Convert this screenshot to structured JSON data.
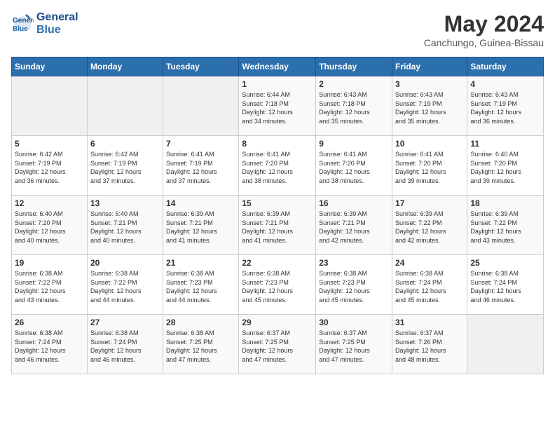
{
  "header": {
    "logo_line1": "General",
    "logo_line2": "Blue",
    "month_year": "May 2024",
    "location": "Canchungo, Guinea-Bissau"
  },
  "calendar": {
    "days_of_week": [
      "Sunday",
      "Monday",
      "Tuesday",
      "Wednesday",
      "Thursday",
      "Friday",
      "Saturday"
    ],
    "weeks": [
      [
        {
          "day": "",
          "info": ""
        },
        {
          "day": "",
          "info": ""
        },
        {
          "day": "",
          "info": ""
        },
        {
          "day": "1",
          "info": "Sunrise: 6:44 AM\nSunset: 7:18 PM\nDaylight: 12 hours\nand 34 minutes."
        },
        {
          "day": "2",
          "info": "Sunrise: 6:43 AM\nSunset: 7:18 PM\nDaylight: 12 hours\nand 35 minutes."
        },
        {
          "day": "3",
          "info": "Sunrise: 6:43 AM\nSunset: 7:19 PM\nDaylight: 12 hours\nand 35 minutes."
        },
        {
          "day": "4",
          "info": "Sunrise: 6:43 AM\nSunset: 7:19 PM\nDaylight: 12 hours\nand 36 minutes."
        }
      ],
      [
        {
          "day": "5",
          "info": "Sunrise: 6:42 AM\nSunset: 7:19 PM\nDaylight: 12 hours\nand 36 minutes."
        },
        {
          "day": "6",
          "info": "Sunrise: 6:42 AM\nSunset: 7:19 PM\nDaylight: 12 hours\nand 37 minutes."
        },
        {
          "day": "7",
          "info": "Sunrise: 6:41 AM\nSunset: 7:19 PM\nDaylight: 12 hours\nand 37 minutes."
        },
        {
          "day": "8",
          "info": "Sunrise: 6:41 AM\nSunset: 7:20 PM\nDaylight: 12 hours\nand 38 minutes."
        },
        {
          "day": "9",
          "info": "Sunrise: 6:41 AM\nSunset: 7:20 PM\nDaylight: 12 hours\nand 38 minutes."
        },
        {
          "day": "10",
          "info": "Sunrise: 6:41 AM\nSunset: 7:20 PM\nDaylight: 12 hours\nand 39 minutes."
        },
        {
          "day": "11",
          "info": "Sunrise: 6:40 AM\nSunset: 7:20 PM\nDaylight: 12 hours\nand 39 minutes."
        }
      ],
      [
        {
          "day": "12",
          "info": "Sunrise: 6:40 AM\nSunset: 7:20 PM\nDaylight: 12 hours\nand 40 minutes."
        },
        {
          "day": "13",
          "info": "Sunrise: 6:40 AM\nSunset: 7:21 PM\nDaylight: 12 hours\nand 40 minutes."
        },
        {
          "day": "14",
          "info": "Sunrise: 6:39 AM\nSunset: 7:21 PM\nDaylight: 12 hours\nand 41 minutes."
        },
        {
          "day": "15",
          "info": "Sunrise: 6:39 AM\nSunset: 7:21 PM\nDaylight: 12 hours\nand 41 minutes."
        },
        {
          "day": "16",
          "info": "Sunrise: 6:39 AM\nSunset: 7:21 PM\nDaylight: 12 hours\nand 42 minutes."
        },
        {
          "day": "17",
          "info": "Sunrise: 6:39 AM\nSunset: 7:22 PM\nDaylight: 12 hours\nand 42 minutes."
        },
        {
          "day": "18",
          "info": "Sunrise: 6:39 AM\nSunset: 7:22 PM\nDaylight: 12 hours\nand 43 minutes."
        }
      ],
      [
        {
          "day": "19",
          "info": "Sunrise: 6:38 AM\nSunset: 7:22 PM\nDaylight: 12 hours\nand 43 minutes."
        },
        {
          "day": "20",
          "info": "Sunrise: 6:38 AM\nSunset: 7:22 PM\nDaylight: 12 hours\nand 44 minutes."
        },
        {
          "day": "21",
          "info": "Sunrise: 6:38 AM\nSunset: 7:23 PM\nDaylight: 12 hours\nand 44 minutes."
        },
        {
          "day": "22",
          "info": "Sunrise: 6:38 AM\nSunset: 7:23 PM\nDaylight: 12 hours\nand 45 minutes."
        },
        {
          "day": "23",
          "info": "Sunrise: 6:38 AM\nSunset: 7:23 PM\nDaylight: 12 hours\nand 45 minutes."
        },
        {
          "day": "24",
          "info": "Sunrise: 6:38 AM\nSunset: 7:24 PM\nDaylight: 12 hours\nand 45 minutes."
        },
        {
          "day": "25",
          "info": "Sunrise: 6:38 AM\nSunset: 7:24 PM\nDaylight: 12 hours\nand 46 minutes."
        }
      ],
      [
        {
          "day": "26",
          "info": "Sunrise: 6:38 AM\nSunset: 7:24 PM\nDaylight: 12 hours\nand 46 minutes."
        },
        {
          "day": "27",
          "info": "Sunrise: 6:38 AM\nSunset: 7:24 PM\nDaylight: 12 hours\nand 46 minutes."
        },
        {
          "day": "28",
          "info": "Sunrise: 6:38 AM\nSunset: 7:25 PM\nDaylight: 12 hours\nand 47 minutes."
        },
        {
          "day": "29",
          "info": "Sunrise: 6:37 AM\nSunset: 7:25 PM\nDaylight: 12 hours\nand 47 minutes."
        },
        {
          "day": "30",
          "info": "Sunrise: 6:37 AM\nSunset: 7:25 PM\nDaylight: 12 hours\nand 47 minutes."
        },
        {
          "day": "31",
          "info": "Sunrise: 6:37 AM\nSunset: 7:26 PM\nDaylight: 12 hours\nand 48 minutes."
        },
        {
          "day": "",
          "info": ""
        }
      ]
    ]
  }
}
